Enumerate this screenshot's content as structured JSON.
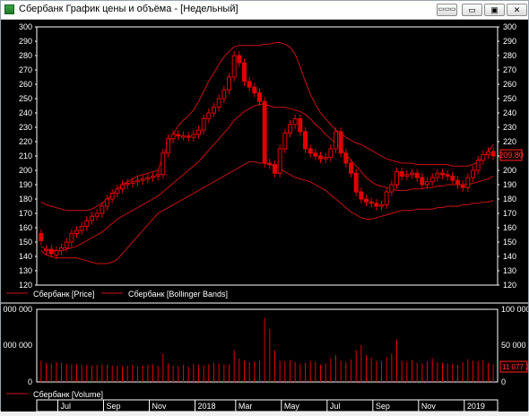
{
  "window": {
    "title": "Сбербанк График цены и объёма - [Недельный]",
    "controls": {
      "pin": "▭▭▭",
      "minimize": "▭",
      "restore": "▣",
      "close": "✕"
    }
  },
  "colors": {
    "background": "#000000",
    "candle": "#e00000",
    "bands": "#cc1010",
    "axis": "#ffffff",
    "price_tag_bg": "#1a0000",
    "price_tag_border": "#ff2020"
  },
  "price_panel": {
    "y_ticks": [
      "300",
      "290",
      "280",
      "270",
      "260",
      "250",
      "240",
      "230",
      "220",
      "210",
      "200",
      "190",
      "180",
      "170",
      "160",
      "150",
      "140",
      "130",
      "120"
    ],
    "current_price": "209.80",
    "legend": [
      {
        "label": "Сбербанк [Price]"
      },
      {
        "label": "Сбербанк [Bollinger Bands]"
      }
    ]
  },
  "volume_panel": {
    "left_ticks": [
      "000 000",
      "000 000",
      "0"
    ],
    "right_ticks": [
      "100 000",
      "50 000",
      "0"
    ],
    "current_volume": "11 077 2",
    "legend": [
      {
        "label": "Сбербанк [Volume]"
      }
    ]
  },
  "x_axis": {
    "labels": [
      "Jul",
      "Sep",
      "Nov",
      "2018",
      "Mar",
      "May",
      "Jul",
      "Sep",
      "Nov",
      "2019"
    ]
  },
  "chart_data": {
    "type": "candlestick",
    "title": "Сбербанк График цены и объёма - [Недельный]",
    "ylim": [
      120,
      300
    ],
    "close": [
      151,
      145,
      142,
      144,
      146,
      150,
      156,
      158,
      161,
      165,
      168,
      170,
      175,
      180,
      184,
      187,
      190,
      191,
      192,
      193,
      194,
      195,
      196,
      197,
      212,
      222,
      225,
      224,
      224,
      223,
      225,
      228,
      236,
      240,
      244,
      250,
      256,
      265,
      280,
      275,
      262,
      258,
      254,
      248,
      205,
      204,
      198,
      215,
      226,
      232,
      236,
      227,
      215,
      212,
      210,
      208,
      209,
      215,
      227,
      212,
      205,
      198,
      185,
      180,
      178,
      177,
      175,
      176,
      185,
      190,
      199,
      196,
      197,
      198,
      195,
      190,
      192,
      195,
      198,
      197,
      196,
      193,
      190,
      188,
      195,
      200,
      207,
      211,
      213,
      210
    ],
    "open": [
      156,
      144,
      145,
      141,
      144,
      146,
      150,
      156,
      158,
      161,
      165,
      168,
      170,
      175,
      180,
      184,
      187,
      190,
      191,
      192,
      193,
      194,
      195,
      196,
      197,
      212,
      222,
      225,
      224,
      224,
      223,
      225,
      228,
      236,
      240,
      244,
      250,
      256,
      265,
      280,
      275,
      262,
      258,
      254,
      248,
      205,
      204,
      198,
      215,
      226,
      232,
      236,
      227,
      215,
      212,
      210,
      208,
      209,
      215,
      227,
      212,
      205,
      198,
      185,
      180,
      178,
      177,
      175,
      176,
      185,
      190,
      199,
      196,
      197,
      198,
      195,
      190,
      192,
      195,
      198,
      197,
      196,
      193,
      190,
      188,
      195,
      200,
      207,
      211,
      213
    ],
    "volume": [
      30,
      27,
      26,
      28,
      27,
      26,
      25,
      25,
      24,
      24,
      23,
      24,
      25,
      24,
      23,
      23,
      22,
      23,
      24,
      22,
      23,
      24,
      25,
      23,
      40,
      26,
      23,
      22,
      24,
      22,
      25,
      24,
      23,
      25,
      27,
      26,
      24,
      25,
      45,
      33,
      30,
      28,
      29,
      30,
      90,
      75,
      45,
      30,
      29,
      31,
      28,
      26,
      27,
      30,
      28,
      24,
      26,
      33,
      38,
      30,
      28,
      32,
      45,
      52,
      38,
      34,
      30,
      29,
      35,
      40,
      60,
      30,
      28,
      31,
      27,
      26,
      29,
      33,
      28,
      27,
      26,
      25,
      24,
      28,
      32,
      30,
      29,
      31,
      27,
      25
    ],
    "bollinger": {
      "middle": [
        147,
        145,
        144,
        144,
        144,
        145,
        146,
        147,
        149,
        151,
        153,
        155,
        157,
        160,
        163,
        166,
        168,
        170,
        172,
        174,
        176,
        178,
        180,
        182,
        185,
        188,
        191,
        194,
        197,
        200,
        203,
        206,
        210,
        214,
        218,
        222,
        226,
        230,
        235,
        238,
        241,
        243,
        245,
        246,
        246,
        245,
        244,
        244,
        244,
        243,
        242,
        241,
        239,
        236,
        232,
        229,
        225,
        222,
        219,
        215,
        211,
        207,
        203,
        199,
        195,
        192,
        190,
        189,
        188,
        187,
        186,
        186,
        186,
        187,
        187,
        187,
        188,
        188,
        189,
        189,
        190,
        190,
        190,
        190,
        190,
        191,
        192,
        193,
        194,
        196
      ],
      "upper": [
        178,
        176,
        175,
        174,
        173,
        172,
        172,
        172,
        172,
        172,
        173,
        175,
        177,
        180,
        183,
        187,
        190,
        192,
        194,
        196,
        197,
        198,
        199,
        200,
        210,
        218,
        225,
        231,
        235,
        238,
        242,
        248,
        255,
        262,
        268,
        274,
        279,
        283,
        286,
        287,
        287,
        287,
        287,
        287,
        288,
        288,
        289,
        289,
        288,
        286,
        281,
        272,
        262,
        253,
        246,
        240,
        236,
        232,
        228,
        226,
        223,
        221,
        219,
        218,
        216,
        214,
        212,
        210,
        208,
        207,
        206,
        205,
        205,
        205,
        204,
        204,
        204,
        204,
        204,
        204,
        204,
        203,
        203,
        203,
        203,
        204,
        206,
        209,
        213,
        218
      ],
      "lower": [
        144,
        141,
        140,
        139,
        139,
        139,
        139,
        139,
        138,
        137,
        136,
        135,
        135,
        135,
        136,
        138,
        142,
        146,
        150,
        154,
        158,
        162,
        166,
        170,
        172,
        174,
        176,
        178,
        180,
        182,
        184,
        186,
        188,
        190,
        192,
        194,
        196,
        198,
        200,
        202,
        204,
        206,
        206,
        205,
        205,
        204,
        203,
        201,
        199,
        197,
        195,
        194,
        193,
        192,
        190,
        188,
        186,
        183,
        180,
        177,
        174,
        171,
        169,
        167,
        166,
        166,
        167,
        168,
        169,
        170,
        171,
        172,
        172,
        172,
        173,
        173,
        173,
        173,
        174,
        174,
        175,
        175,
        175,
        176,
        176,
        177,
        177,
        178,
        178,
        179
      ]
    }
  }
}
